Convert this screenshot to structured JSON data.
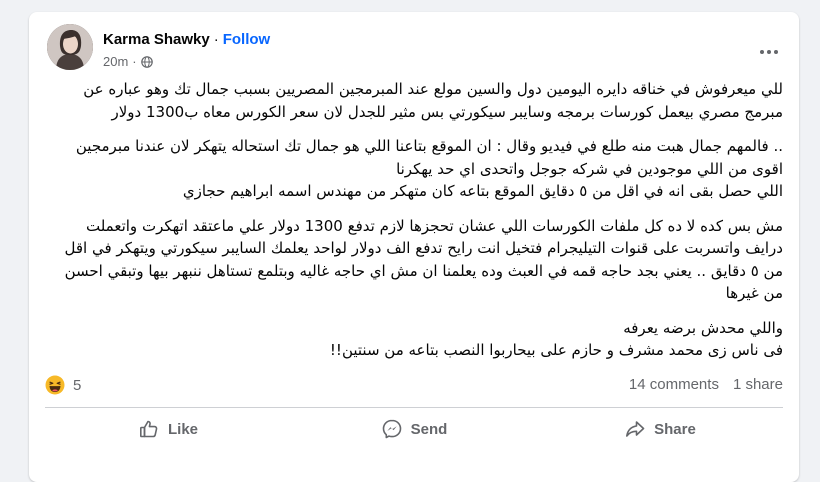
{
  "post": {
    "author": "Karma Shawky",
    "separator": "·",
    "follow_label": "Follow",
    "time": "20m",
    "meta_separator": "·",
    "privacy_icon": "globe-icon",
    "more_icon": "more-options-icon",
    "paragraphs": [
      "للي ميعرفوش في خناقه دايره اليومين دول والسين مولع عند المبرمجين المصريين بسبب جمال تك وهو عباره عن مبرمج مصري بيعمل كورسات برمجه وسايبر سيكورتي بس مثير للجدل لان سعر الكورس معاه ب1300 دولار",
      ".. فالمهم جمال هبت منه طلع في فيديو وقال : ان الموقع بتاعنا اللي هو جمال تك استحاله يتهكر لان عندنا مبرمجين اقوى من اللي موجودين في شركه جوجل واتحدى اي حد يهكرنا\nاللي حصل بقى انه في اقل من ٥ دقايق الموقع بتاعه كان متهكر من مهندس اسمه ابراهيم حجازي",
      "مش بس كده لا ده كل ملفات الكورسات اللي عشان تحجزها لازم تدفع 1300 دولار علي ماعتقد اتهكرت واتعملت درايف واتسربت على قنوات التيليجرام فتخيل انت رايح تدفع الف دولار لواحد يعلمك السايبر سيكورتي ويتهكر في اقل من ٥ دقايق .. يعني بجد حاجه قمه في العبث وده يعلمنا ان مش اي حاجه غاليه وبتلمع تستاهل ننبهر بيها وتبقي احسن من غيرها",
      "واللي محدش برضه يعرفه\nفى ناس زى محمد مشرف و حازم على بيحاربوا النصب بتاعه من سنتين!!"
    ]
  },
  "stats": {
    "reaction_icon": "haha-reaction-icon",
    "reaction_count": "5",
    "comments": "14 comments",
    "shares": "1 share"
  },
  "actions": {
    "like": "Like",
    "send": "Send",
    "share": "Share"
  },
  "colors": {
    "background": "#f0f2f5",
    "card": "#ffffff",
    "follow": "#0866ff",
    "secondary_text": "#65676b",
    "haha": "#f7b928"
  }
}
